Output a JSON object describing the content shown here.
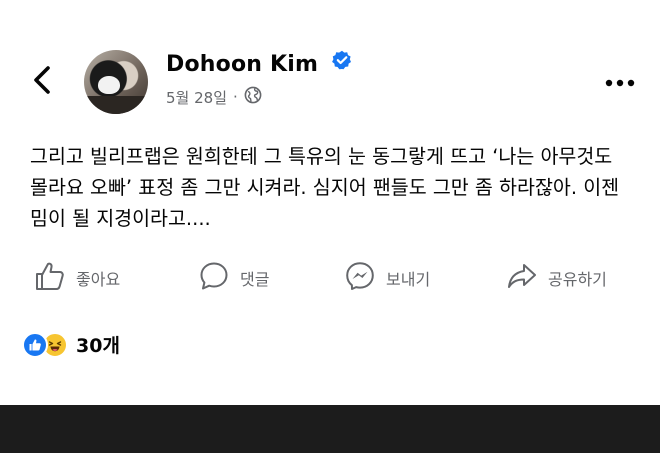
{
  "post": {
    "author": "Dohoon Kim",
    "date": "5월 28일",
    "separator": "·",
    "text": "그리고 빌리프랩은 원희한테 그 특유의 눈 동그랗게 뜨고 ‘나는 아무것도 몰라요 오빠’ 표정 좀 그만 시켜라. 심지어 팬들도 그만 좀 하라잖아. 이젠 밈이 될 지경이라고...."
  },
  "icons": {
    "back": "back-arrow-icon",
    "verified": "verified-badge-icon",
    "privacy": "globe-icon",
    "more": "more-options-icon",
    "like": "thumbs-up-icon",
    "comment": "comment-bubble-icon",
    "send": "messenger-icon",
    "share": "share-arrow-icon",
    "reaction_like": "like-reaction-icon",
    "reaction_haha": "haha-reaction-icon"
  },
  "actions": {
    "like": "좋아요",
    "comment": "댓글",
    "send": "보내기",
    "share": "공유하기"
  },
  "reactions": {
    "count": "30개"
  },
  "colors": {
    "text": "#050505",
    "secondary": "#65676b",
    "brand": "#1877f2",
    "haha": "#f7c531"
  }
}
